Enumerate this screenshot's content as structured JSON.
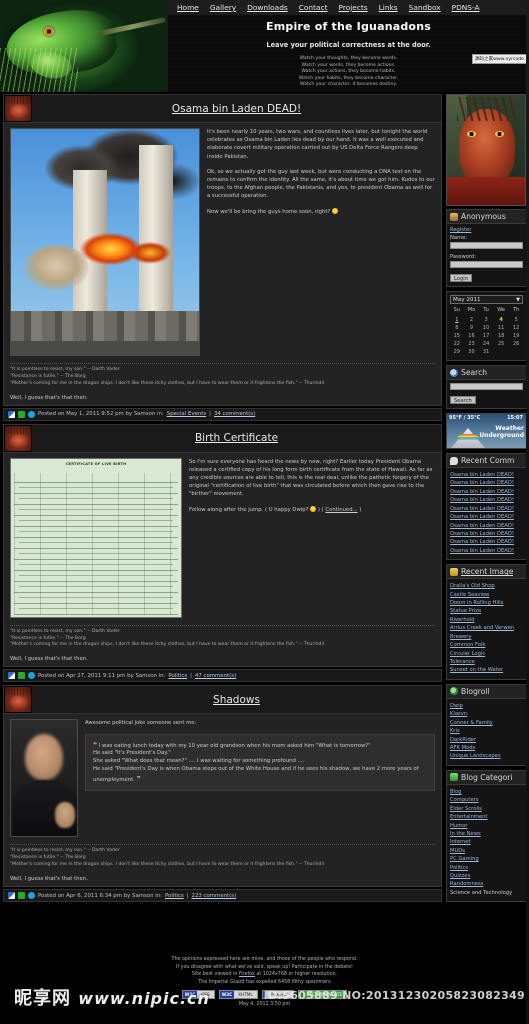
{
  "header": {
    "nav": [
      {
        "label": "Home"
      },
      {
        "label": "Gallery"
      },
      {
        "label": "Downloads"
      },
      {
        "label": "Contact"
      },
      {
        "label": "Projects"
      },
      {
        "label": "Links"
      },
      {
        "label": "Sandbox"
      },
      {
        "label": "PDNS-A"
      }
    ],
    "site_title": "Empire of the Iguanadons",
    "tagline": "Leave your political correctness at the door.",
    "quote_lines": [
      "Watch your thoughts, they become words.",
      "Watch your words, they become actions.",
      "Watch your actions, they become habits.",
      "Watch your habits, they become character.",
      "Watch your character, it becomes destiny."
    ],
    "watermark_badge": "源码之家www.nyrcode"
  },
  "posts": [
    {
      "title": "Osama bin Laden DEAD!",
      "image_name": "twin-towers-explosion-photo",
      "paragraphs": [
        "It's been nearly 10 years, two wars, and countless lives later, but tonight the world celebrates as Osama bin Laden lies dead by our hand. It was a well executed and elaborate covert military operation carried out by US Delta Force Rangers deep inside Pakistan.",
        "Ok, so we actually got the guy last week, but were conducting a DNA test on the remains to confirm the identity. All the same, it's about time we got him. Kudos to our troops, to the Afghan people, the Pakistanis, and yes, to president Obama as well for a successful operation.",
        "Now we'll be bring the guys home soon, right?"
      ],
      "link_text": "so we actually got the guy last week",
      "signature": [
        "\"It is pointless to resist, my son.\" -- Darth Vader",
        "\"Resistance is futile.\" -- The Borg",
        "\"Mother's coming for me in the dragon ships. I don't like these itchy clothes, but I have to wear them or it frightens the fish.\" -- Thurindil"
      ],
      "sig_after": "Well, I guess that's that then.",
      "footer": {
        "posted": "Posted on May 1, 2011 9:52 pm by Samson in:",
        "category": "Special Events",
        "separator": "|",
        "comments": "34 comment(s)"
      }
    },
    {
      "title": "Birth Certificate",
      "image_name": "obama-birth-certificate-scan",
      "cert_heading": "CERTIFICATE OF LIVE BIRTH",
      "paragraphs": [
        "So I'm sure everyone has heard the news by now, right? Earlier today President Obama released a certified copy of his long form birth certificate from the state of Hawaii. As far as any credible sources are able to tell, this is the real deal, unlike the pathetic forgery of the original \"certification of live birth\" that was circulated before which then gave rise to the \"birther\" movement.",
        "Follow along after the jump. ( U happy Dwip?"
      ],
      "continued_prefix": ") (",
      "continued_link": "Continued...",
      "continued_suffix": ")",
      "signature": [
        "\"It is pointless to resist, my son.\" -- Darth Vader",
        "\"Resistance is futile.\" -- The Borg",
        "\"Mother's coming for me in the dragon ships. I don't like these itchy clothes, but I have to wear them or it frightens the fish.\" -- Thurindil"
      ],
      "sig_after": "Well, I guess that's that then.",
      "footer": {
        "posted": "Posted on Apr 27, 2011 9:11 pm by Samson in:",
        "category": "Politics",
        "separator": "|",
        "comments": "47 comment(s)"
      }
    },
    {
      "title": "Shadows",
      "image_name": "obama-speaking-photo",
      "intro": "Awesome political joke someone sent me:",
      "quote_lines": [
        "I was eating lunch today with my 10 year old grandson when his mom asked him \"What is tomorrow?\"",
        "He said \"It's President's Day.\"",
        "She asked \"What does that mean?\" .... I was waiting for something profound ....",
        "He said \"President's Day is when Obama steps out of the White House and if he sees his shadow, we have 2 more years of unemployment."
      ],
      "signature": [
        "\"It is pointless to resist, my son.\" -- Darth Vader",
        "\"Resistance is futile.\" -- The Borg",
        "\"Mother's coming for me in the dragon ships. I don't like these itchy clothes, but I have to wear them or it frightens the fish.\" -- Thurindil"
      ],
      "sig_after": "Well, I guess that's that then.",
      "footer": {
        "posted": "Posted on Apr 6, 2011 6:34 pm by Samson in:",
        "category": "Politics",
        "separator": "|",
        "comments": "223 comment(s)"
      }
    }
  ],
  "sidebar": {
    "top_image_name": "dragon-avatar-large",
    "account": {
      "title": "Anonymous",
      "register_label": "Register",
      "name_label": "Name:",
      "name_value": "",
      "password_label": "Password:",
      "password_value": "",
      "login_label": "Login"
    },
    "calendar": {
      "month_value": "May 2011",
      "weekdays": [
        "Su",
        "Mo",
        "Tu",
        "We",
        "Th"
      ],
      "weeks": [
        [
          "",
          "",
          "",
          "",
          ""
        ],
        [
          "1",
          "2",
          "3",
          "4",
          "5"
        ],
        [
          "8",
          "9",
          "10",
          "11",
          "12"
        ],
        [
          "15",
          "16",
          "17",
          "18",
          "19"
        ],
        [
          "22",
          "23",
          "24",
          "25",
          "26"
        ],
        [
          "29",
          "30",
          "31",
          "",
          ""
        ]
      ],
      "today": "4",
      "linked_day": "1"
    },
    "search": {
      "title": "Search",
      "value": "",
      "button_label": "Search"
    },
    "weather": {
      "temp": "95°F / 35°C",
      "time": "15:07",
      "brand_line1": "Weather",
      "brand_line2": "Underground"
    },
    "recent_comments": {
      "title": "Recent Comm",
      "items": [
        "Osama bin Laden DEAD!",
        "Osama bin Laden DEAD!",
        "Osama bin Laden DEAD!",
        "Osama bin Laden DEAD!",
        "Osama bin Laden DEAD!",
        "Osama bin Laden DEAD!",
        "Osama bin Laden DEAD!",
        "Osama bin Laden DEAD!",
        "Osama bin Laden DEAD!",
        "Osama bin Laden DEAD!"
      ]
    },
    "recent_images": {
      "title": "Recent Image",
      "items": [
        "Dralla's Old Shop",
        "Castle Seaview",
        "Doom in Rolling Hills",
        "Statue Prize",
        "Riverhold",
        "Arrius Creek and Verwen",
        "Brewery",
        "Common Folk",
        "Circular Logic",
        "Tolerance",
        "Sunset on the Water"
      ]
    },
    "blogroll": {
      "title": "Blogroll",
      "items": [
        "Dwip",
        "Klasvn",
        "Conner & Family",
        "Kris",
        "DarkRider",
        "AFK Mods",
        "Unique Landscapes"
      ]
    },
    "blog_categories": {
      "title": "Blog Categori",
      "items": [
        "Blog",
        "Computers",
        "Elder Scrolls",
        "Entertainment",
        "Humor",
        "In the News",
        "Internet",
        "MUDs",
        "PC Gaming",
        "Politics",
        "Quizzes",
        "Randomness",
        "Science and Technology"
      ]
    }
  },
  "footer": {
    "lines": [
      "The opinions expressed here are mine, and those of the people who respond.",
      "If you disagree with what we've said, speak up! Participate in the debate!"
    ],
    "browser_line_prefix": "Site best viewed in",
    "browser_link": "Firefox",
    "browser_line_suffix": "at 1024x768 or higher resolution.",
    "spam_line": "The Imperial Guard has expelled 6458 filthy spammers",
    "badges": [
      {
        "left": "W3C",
        "right": "CSS"
      },
      {
        "left": "W3C",
        "right": "XHTML"
      },
      {
        "left": "",
        "right": "Powered"
      },
      {
        "left": "",
        "right": "RECOMMENDATE"
      }
    ],
    "date": "May 4, 2011 3:50 pm",
    "watermark_text": "昵享网",
    "watermark_url": "www.nipic.cn",
    "watermark_id": "ID:5605889 NO:20131230205823082349"
  },
  "colors": {
    "accent_link": "#9fb9d8",
    "title_text": "#ffffff",
    "panel_bg": "#232323",
    "page_bg": "#000000",
    "today_highlight": "#f5d000"
  }
}
